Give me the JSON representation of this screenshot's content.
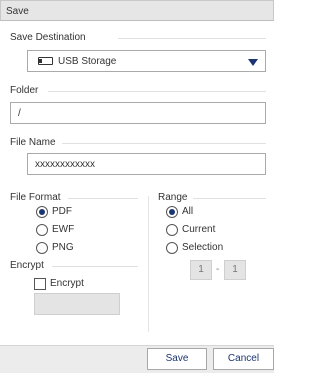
{
  "window": {
    "title": "Save"
  },
  "destination": {
    "label": "Save Destination",
    "selected": "USB Storage",
    "icon": "usb-storage-icon"
  },
  "folder": {
    "label": "Folder",
    "value": "/"
  },
  "file_name": {
    "label": "File Name",
    "value": "xxxxxxxxxxxx"
  },
  "file_format": {
    "label": "File Format",
    "options": [
      {
        "label": "PDF",
        "checked": true
      },
      {
        "label": "EWF",
        "checked": false
      },
      {
        "label": "PNG",
        "checked": false
      }
    ]
  },
  "range": {
    "label": "Range",
    "options": [
      {
        "label": "All",
        "checked": true
      },
      {
        "label": "Current",
        "checked": false
      },
      {
        "label": "Selection",
        "checked": false
      }
    ],
    "from": "1",
    "separator": "-",
    "to": "1"
  },
  "encrypt": {
    "section_label": "Encrypt",
    "checkbox_label": "Encrypt",
    "checked": false
  },
  "buttons": {
    "save": "Save",
    "cancel": "Cancel"
  },
  "colors": {
    "accent": "#1a3572",
    "footer_bg": "#ececec",
    "disabled_bg": "#e4e4e4"
  }
}
